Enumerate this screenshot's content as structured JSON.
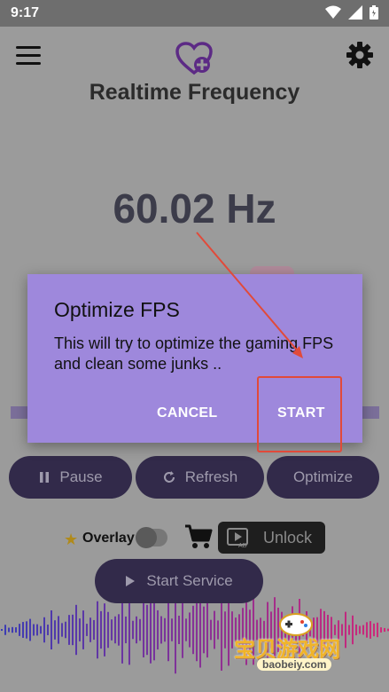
{
  "status_bar": {
    "time": "9:17"
  },
  "app": {
    "title": "Realtime Frequency",
    "frequency": "60.02 Hz"
  },
  "controls": {
    "pause_label": "Pause",
    "refresh_label": "Refresh",
    "optimize_label": "Optimize",
    "overlay_label": "Overlay",
    "unlock_label": "Unlock",
    "ad_badge": "AD",
    "start_service_label": "Start Service"
  },
  "dialog": {
    "title": "Optimize FPS",
    "message": "This will try to optimize the gaming FPS and clean some junks ..",
    "cancel_label": "CANCEL",
    "start_label": "START"
  },
  "watermark": {
    "text": "宝贝游戏网",
    "url": "baobeiy.com"
  },
  "colors": {
    "dialog_bg": "#9e88dc",
    "accent_purple": "#6a2a9a",
    "pill_bg": "#322a4a",
    "annotation_red": "#e14a3a"
  },
  "icons": [
    "menu-icon",
    "heart-plus-icon",
    "gear-icon",
    "pause-icon",
    "refresh-icon",
    "star-icon",
    "cart-icon",
    "play-icon"
  ]
}
